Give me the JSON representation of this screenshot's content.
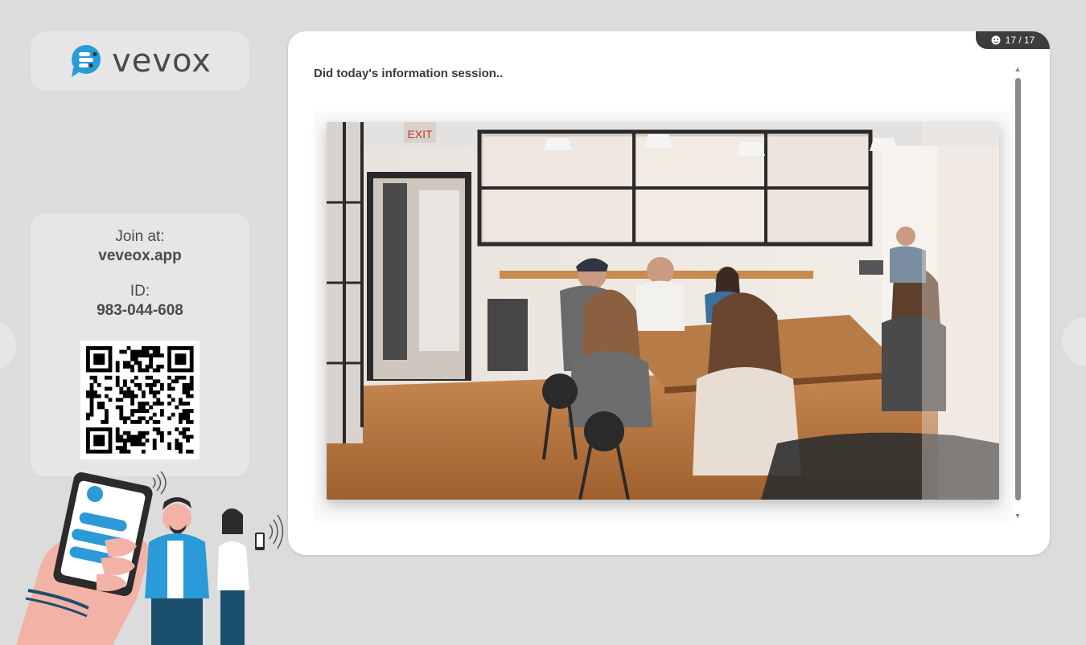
{
  "brand": {
    "name": "vevox"
  },
  "join": {
    "label": "Join at:",
    "url": "veveox.app",
    "id_label": "ID:",
    "id_value": "983-044-608"
  },
  "counter": {
    "icon": "smile-icon",
    "text": "17 / 17"
  },
  "question": {
    "text": "Did today's information session.."
  },
  "colors": {
    "brand_blue": "#2b9ad8",
    "card_bg": "#e6e6e6",
    "counter_bg": "#3d3d3d"
  }
}
